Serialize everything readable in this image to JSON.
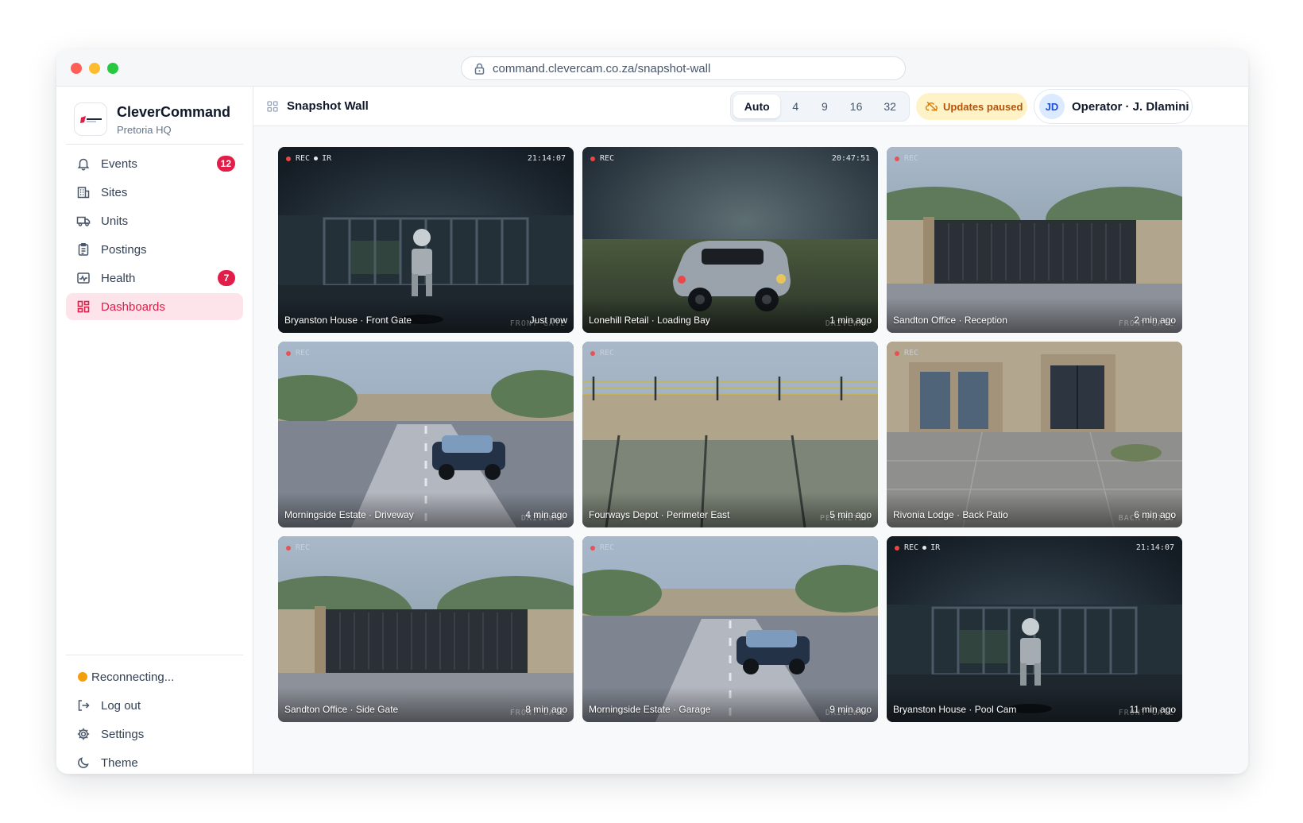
{
  "browser": {
    "url": "command.clevercam.co.za/snapshot-wall"
  },
  "brand": {
    "name": "CleverCommand",
    "subtitle": "Pretoria HQ"
  },
  "nav": [
    {
      "label": "Events",
      "icon": "bell-icon",
      "badge": "12"
    },
    {
      "label": "Sites",
      "icon": "building-icon",
      "badge": ""
    },
    {
      "label": "Units",
      "icon": "truck-icon",
      "badge": ""
    },
    {
      "label": "Postings",
      "icon": "clipboard-icon",
      "badge": ""
    },
    {
      "label": "Health",
      "icon": "pulse-icon",
      "badge": "7"
    },
    {
      "label": "Dashboards",
      "icon": "dashboard-grid-icon",
      "badge": "",
      "active": true
    }
  ],
  "footer_nav": {
    "connection_status": "Reconnecting...",
    "logout": "Log out",
    "settings": "Settings",
    "theme": "Theme"
  },
  "topbar": {
    "title": "Snapshot Wall",
    "layout_options": [
      "Auto",
      "4",
      "9",
      "16",
      "32"
    ],
    "layout_selected": "Auto",
    "status": "Updates paused",
    "operator_initials": "JD",
    "operator_name": "Operator · J. Dlamini"
  },
  "colors": {
    "accent": "#e11d48",
    "paused_bg": "#fef3c7",
    "paused_text": "#b45309",
    "status_warning": "#f59e0b"
  },
  "tiles": [
    {
      "name": "Bryanston House · Front Gate",
      "age": "Just now",
      "rec": "REC",
      "ir": "IR",
      "timestamp": "21:14:07",
      "tag": "FRONT GATE",
      "scene": "night-gate"
    },
    {
      "name": "Lonehill Retail · Loading Bay",
      "age": "1 min ago",
      "rec": "REC",
      "ir": "",
      "timestamp": "20:47:51",
      "tag": "DRIVEWAY",
      "scene": "night-car"
    },
    {
      "name": "Sandton Office · Reception",
      "age": "2 min ago",
      "rec": "REC",
      "ir": "",
      "timestamp": "",
      "tag": "FRONT GATE",
      "scene": "day-gate"
    },
    {
      "name": "Morningside Estate · Driveway",
      "age": "4 min ago",
      "rec": "REC",
      "ir": "",
      "timestamp": "",
      "tag": "DRIVEWAY",
      "scene": "day-driveway"
    },
    {
      "name": "Fourways Depot · Perimeter East",
      "age": "5 min ago",
      "rec": "REC",
      "ir": "",
      "timestamp": "",
      "tag": "PERIMETER",
      "scene": "day-perimeter"
    },
    {
      "name": "Rivonia Lodge · Back Patio",
      "age": "6 min ago",
      "rec": "REC",
      "ir": "",
      "timestamp": "",
      "tag": "BACK PATIO",
      "scene": "day-patio"
    },
    {
      "name": "Sandton Office · Side Gate",
      "age": "8 min ago",
      "rec": "REC",
      "ir": "",
      "timestamp": "",
      "tag": "FRONT GATE",
      "scene": "day-gate"
    },
    {
      "name": "Morningside Estate · Garage",
      "age": "9 min ago",
      "rec": "REC",
      "ir": "",
      "timestamp": "",
      "tag": "DRIVEWAY",
      "scene": "day-driveway"
    },
    {
      "name": "Bryanston House · Pool Cam",
      "age": "11 min ago",
      "rec": "REC",
      "ir": "IR",
      "timestamp": "21:14:07",
      "tag": "FRONT GATE",
      "scene": "night-gate"
    }
  ]
}
